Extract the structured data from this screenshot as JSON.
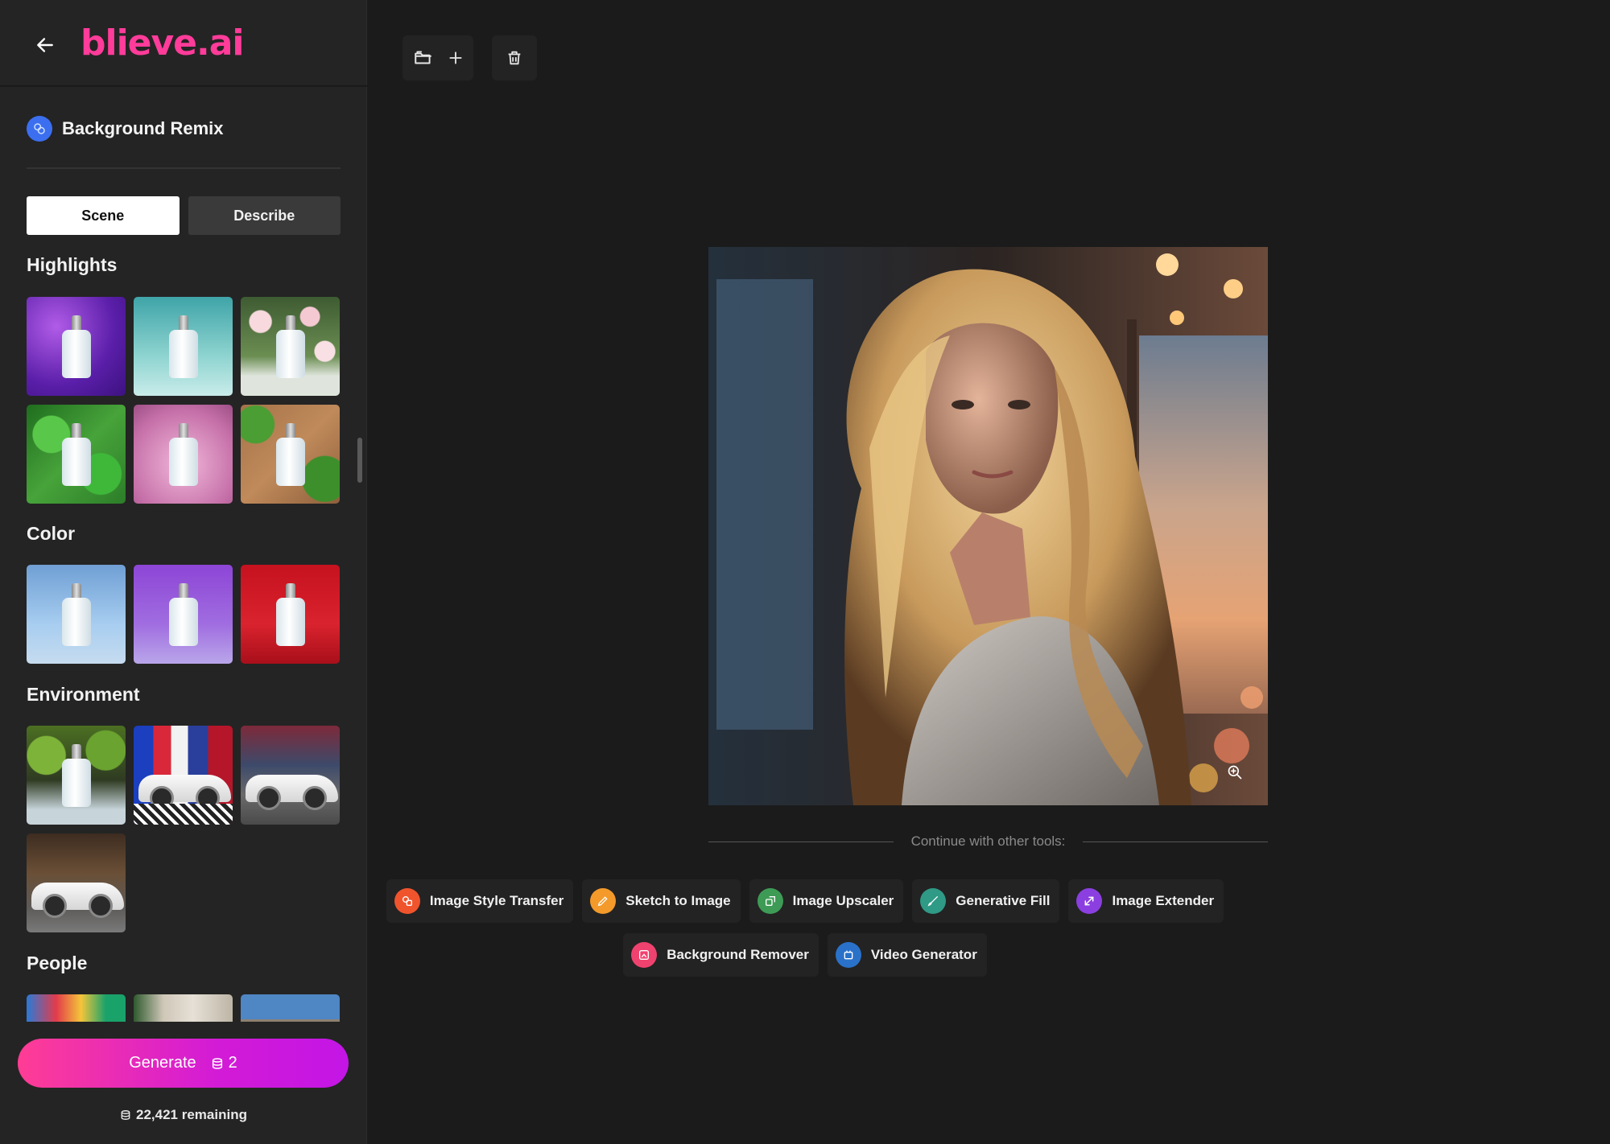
{
  "app": {
    "logo": "blieve.ai"
  },
  "sidebar": {
    "tool_title": "Background Remix",
    "tabs": [
      {
        "label": "Scene",
        "active": true
      },
      {
        "label": "Describe",
        "active": false
      }
    ],
    "sections": [
      {
        "title": "Highlights",
        "items": [
          "purple-feathers",
          "teal-water",
          "white-roses",
          "tropical-leaves",
          "pink-clouds",
          "wood-monstera"
        ]
      },
      {
        "title": "Color",
        "items": [
          "blue",
          "purple",
          "red"
        ]
      },
      {
        "title": "Environment",
        "items": [
          "mossy-rocks",
          "city-billboards",
          "street-night",
          "old-town-street"
        ]
      },
      {
        "title": "People",
        "items": [
          "graffiti-wall",
          "building-facade",
          "mountain-sky"
        ]
      }
    ],
    "generate": {
      "label": "Generate",
      "cost": "2"
    },
    "remaining": "22,421 remaining"
  },
  "toolbar": {
    "open_icon": "folder-open-icon",
    "add_icon": "plus-icon",
    "delete_icon": "trash-icon"
  },
  "canvas": {
    "image_subject": "blonde woman by window at sunset",
    "zoom_icon": "zoom-in-icon"
  },
  "continue": {
    "label": "Continue with other tools:",
    "tools": [
      {
        "label": "Image Style Transfer",
        "color": "#f0542d",
        "icon": "style-transfer-icon"
      },
      {
        "label": "Sketch to Image",
        "color": "#f39a2b",
        "icon": "pencil-icon"
      },
      {
        "label": "Image Upscaler",
        "color": "#3e9b55",
        "icon": "upscale-icon"
      },
      {
        "label": "Generative Fill",
        "color": "#2f9a86",
        "icon": "brush-icon"
      },
      {
        "label": "Image Extender",
        "color": "#8b3fe0",
        "icon": "expand-arrows-icon"
      },
      {
        "label": "Background Remover",
        "color": "#f0426e",
        "icon": "background-remove-icon"
      },
      {
        "label": "Video Generator",
        "color": "#2a72c9",
        "icon": "video-icon"
      }
    ]
  }
}
